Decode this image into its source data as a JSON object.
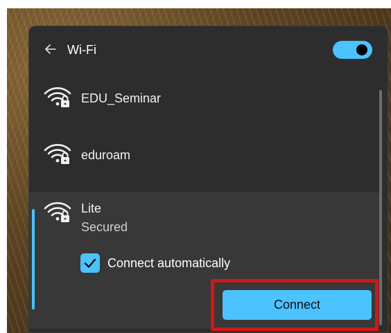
{
  "header": {
    "title": "Wi-Fi",
    "back_icon": "back-arrow-icon",
    "wifi_toggle_on": true,
    "accent_color": "#4cc2ff"
  },
  "networks": [
    {
      "name": "EDU_Seminar",
      "icon": "wifi-secured-icon"
    },
    {
      "name": "eduroam",
      "icon": "wifi-secured-icon"
    },
    {
      "name": "Lite",
      "status": "Secured",
      "icon": "wifi-secured-icon",
      "expanded": true
    }
  ],
  "selected_network": {
    "auto_connect_label": "Connect automatically",
    "auto_connect_checked": true,
    "connect_label": "Connect"
  },
  "annotation": {
    "highlight_color": "#d01818",
    "target": "connect-button"
  }
}
